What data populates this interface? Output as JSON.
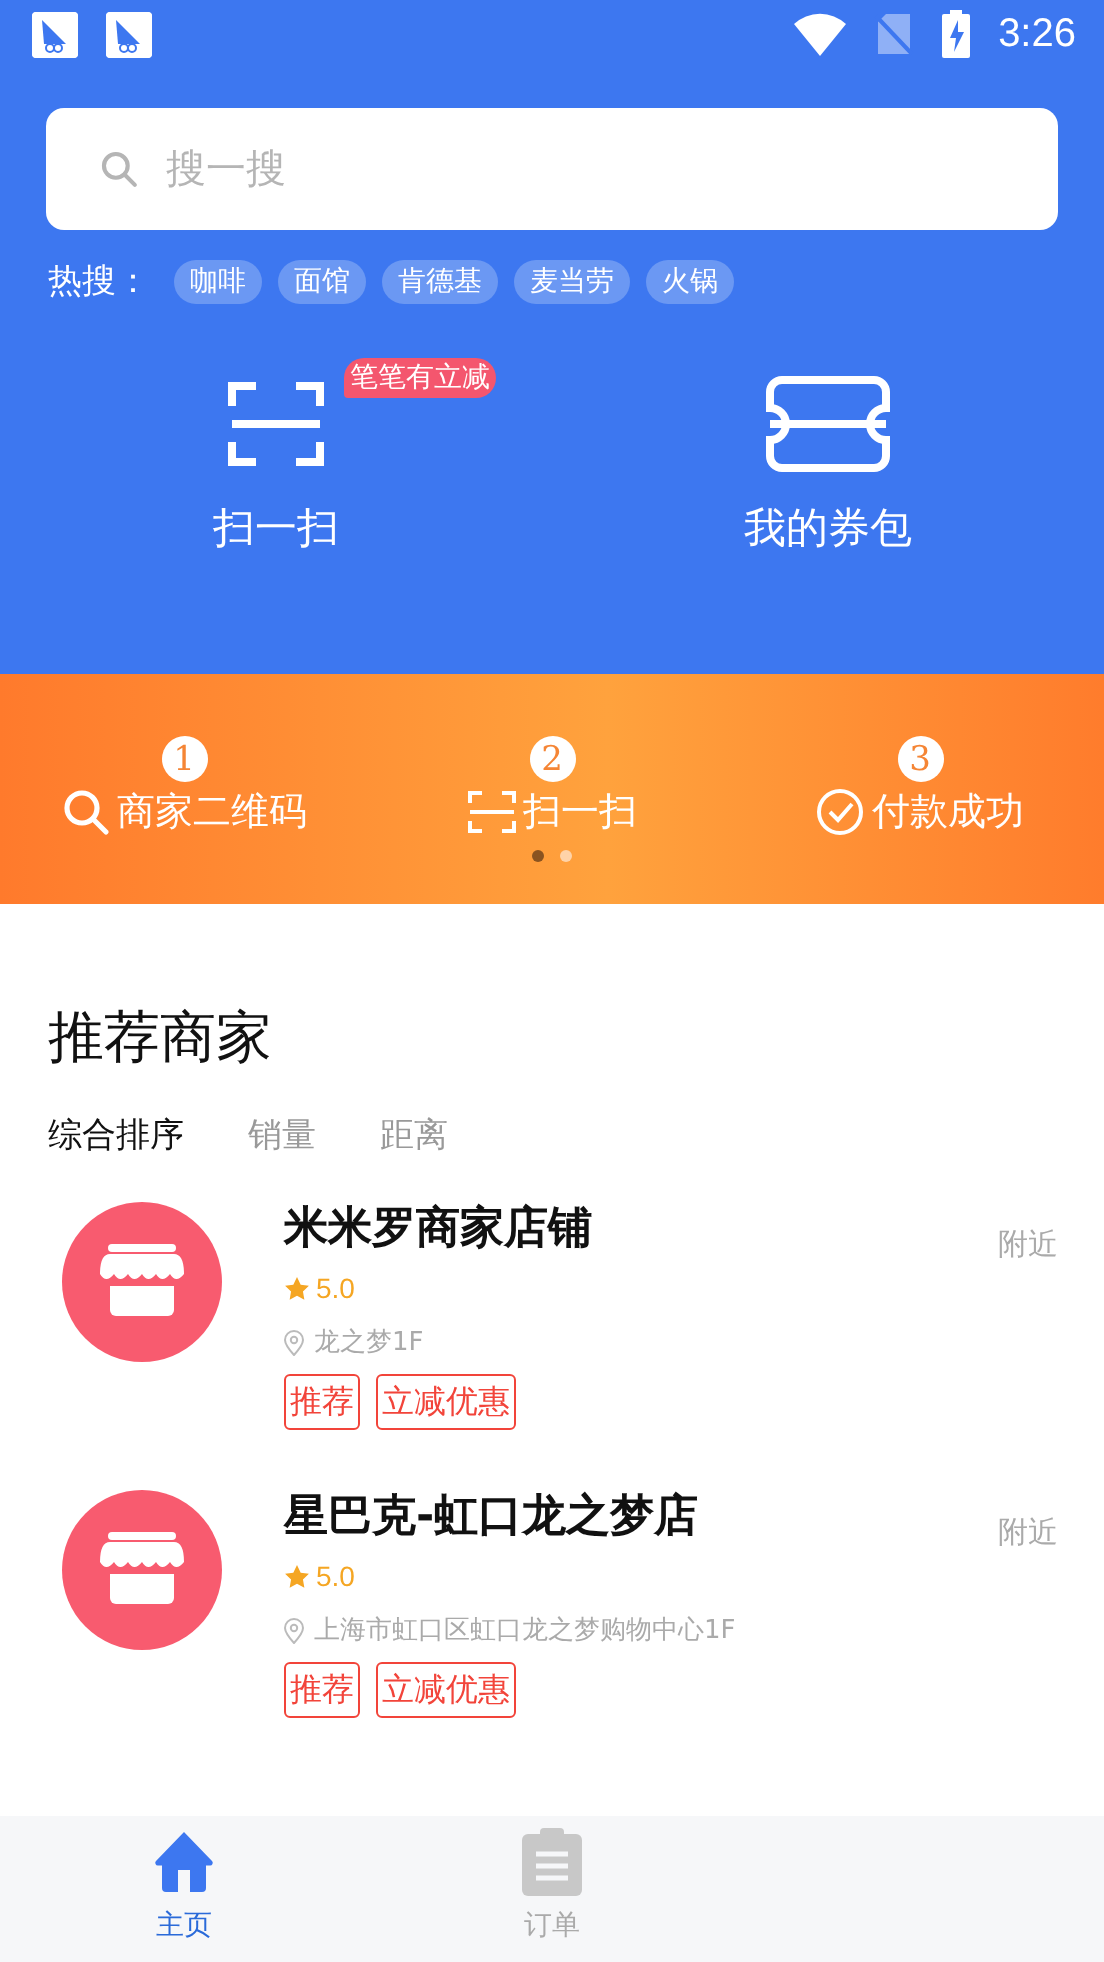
{
  "status_bar": {
    "time": "3:26"
  },
  "search": {
    "placeholder": "搜一搜"
  },
  "hot_search": {
    "label": "热搜：",
    "tags": [
      "咖啡",
      "面馆",
      "肯德基",
      "麦当劳",
      "火锅"
    ]
  },
  "actions": [
    {
      "kind": "scan",
      "label": "扫一扫",
      "badge": "笔笔有立减"
    },
    {
      "kind": "coupon",
      "label": "我的券包"
    }
  ],
  "steps": [
    {
      "number": "1",
      "kind": "search",
      "label": "商家二维码"
    },
    {
      "number": "2",
      "kind": "scan",
      "label": "扫一扫"
    },
    {
      "number": "3",
      "kind": "check",
      "label": "付款成功"
    }
  ],
  "pager": [
    {
      "selected": true
    },
    {
      "selected": false
    }
  ],
  "section_title": "推荐商家",
  "sort_tabs": [
    {
      "label": "综合排序",
      "selected": true
    },
    {
      "label": "销量",
      "selected": false
    },
    {
      "label": "距离",
      "selected": false
    }
  ],
  "merchants": [
    {
      "name": "米米罗商家店铺",
      "rating": "5.0",
      "address": "龙之梦1F",
      "distance": "附近",
      "tags": [
        "推荐",
        "立减优惠"
      ]
    },
    {
      "name": "星巴克-虹口龙之梦店",
      "rating": "5.0",
      "address": "上海市虹口区虹口龙之梦购物中心1F",
      "distance": "附近",
      "tags": [
        "推荐",
        "立减优惠"
      ]
    }
  ],
  "bottom_nav": [
    {
      "kind": "home",
      "label": "主页",
      "selected": true
    },
    {
      "kind": "orders",
      "label": "订单",
      "selected": false
    }
  ]
}
